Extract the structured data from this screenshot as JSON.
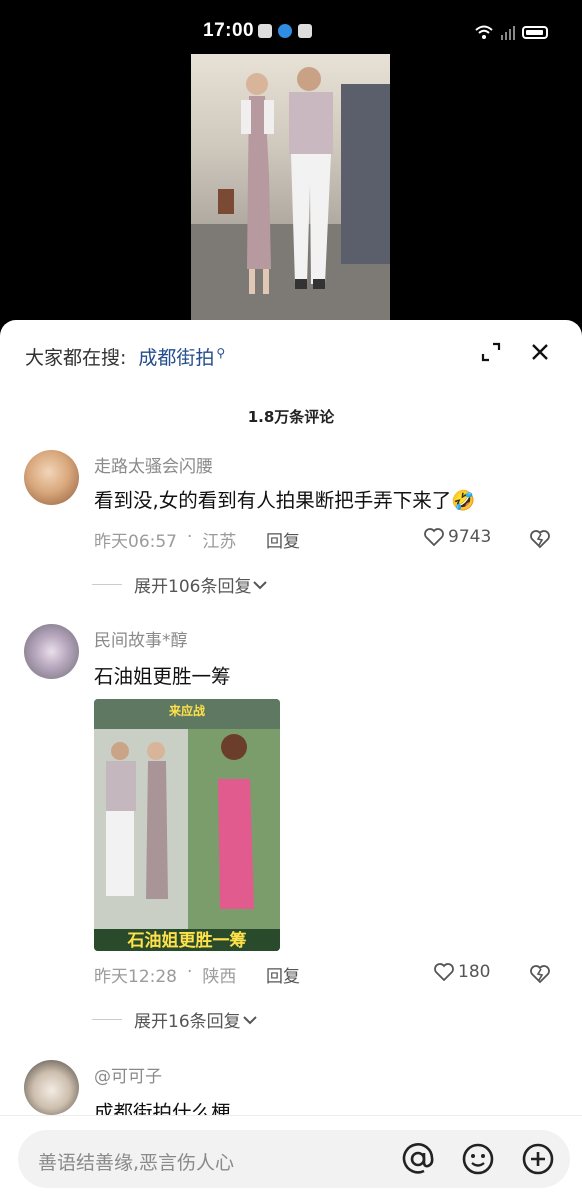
{
  "status_bar": {
    "time": "17:00"
  },
  "search": {
    "label": "大家都在搜:",
    "keyword": "成都街拍"
  },
  "comments_header": {
    "count": "1.8万条评论"
  },
  "comments": [
    {
      "username": "走路太骚会闪腰",
      "text": "看到没,女的看到有人拍果断把手弄下来了🤣",
      "time": "昨天06:57",
      "location": "江苏",
      "reply_label": "回复",
      "likes": "9743",
      "expand_label": "展开106条回复"
    },
    {
      "username": "民间故事*醇",
      "text": "石油姐更胜一筹",
      "image_caption_top": "来应战",
      "image_caption_bottom": "石油姐更胜一筹",
      "time": "昨天12:28",
      "location": "陕西",
      "reply_label": "回复",
      "likes": "180",
      "expand_label": "展开16条回复"
    },
    {
      "username": "@可可子",
      "text": "成都街拍什么梗"
    }
  ],
  "input": {
    "placeholder": "善语结善缘,恶言伤人心"
  },
  "colors": {
    "link": "#234d8c",
    "sheet_bg": "#ffffff",
    "video_bg": "#000000"
  }
}
